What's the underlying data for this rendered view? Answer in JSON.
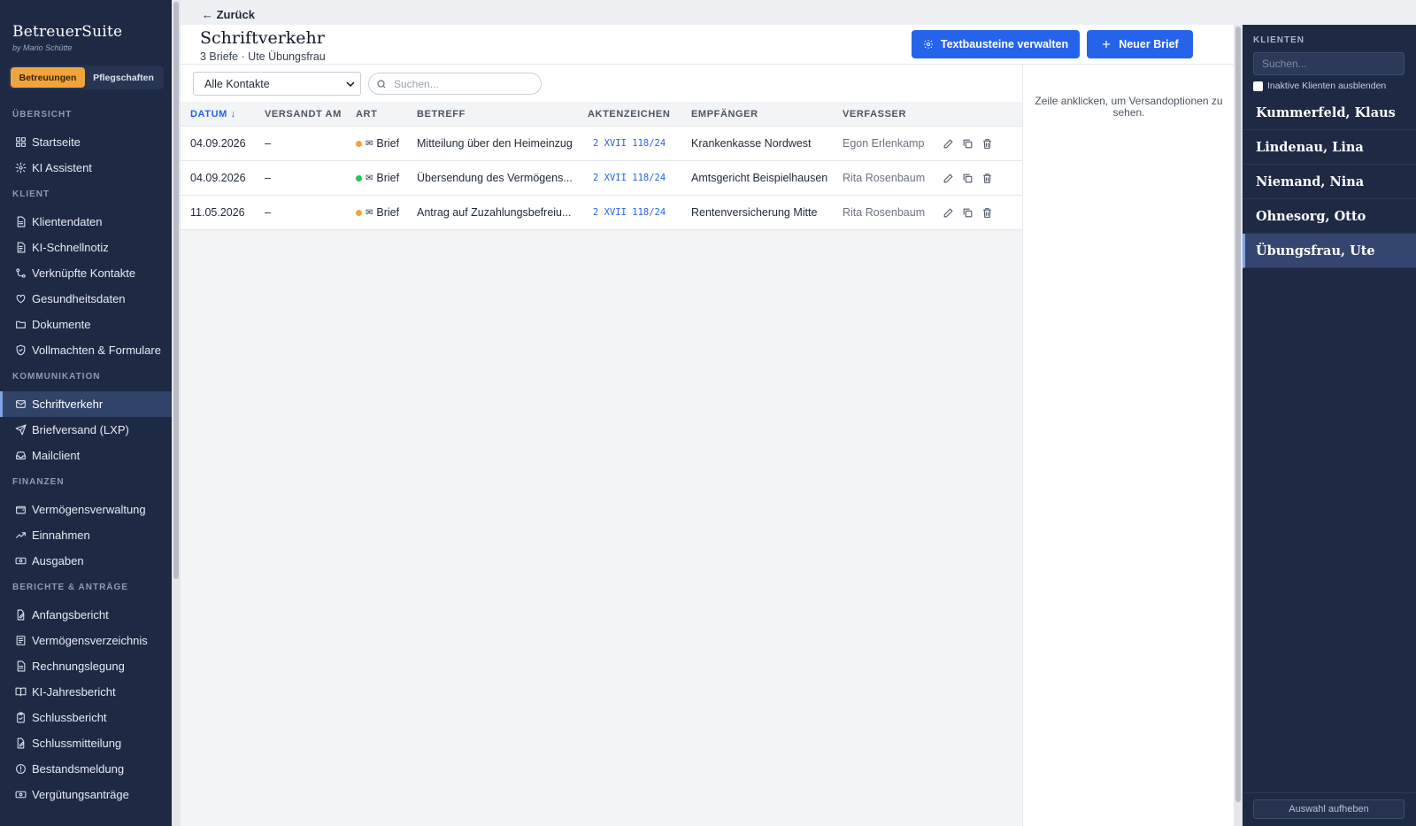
{
  "app": {
    "brand": "BetreuerSuite",
    "brand_sub": "by Mario Schütte",
    "modes": [
      "Betreuungen",
      "Pflegschaften"
    ]
  },
  "sidebar": {
    "sections": [
      {
        "title": "ÜBERSICHT",
        "items": [
          {
            "label": "Startseite",
            "icon": "home-icon"
          },
          {
            "label": "KI Assistent",
            "icon": "gear-icon"
          }
        ]
      },
      {
        "title": "KLIENT",
        "items": [
          {
            "label": "Klientendaten",
            "icon": "document-icon"
          },
          {
            "label": "KI-Schnellnotiz",
            "icon": "note-icon"
          },
          {
            "label": "Verknüpfte Kontakte",
            "icon": "link-icon"
          },
          {
            "label": "Gesundheitsdaten",
            "icon": "heart-icon"
          },
          {
            "label": "Dokumente",
            "icon": "folder-icon"
          },
          {
            "label": "Vollmachten & Formulare",
            "icon": "shield-icon"
          }
        ]
      },
      {
        "title": "KOMMUNIKATION",
        "items": [
          {
            "label": "Schriftverkehr",
            "icon": "mail-icon",
            "active": true
          },
          {
            "label": "Briefversand (LXP)",
            "icon": "send-icon"
          },
          {
            "label": "Mailclient",
            "icon": "inbox-icon"
          }
        ]
      },
      {
        "title": "FINANZEN",
        "items": [
          {
            "label": "Vermögensverwaltung",
            "icon": "wallet-icon"
          },
          {
            "label": "Einnahmen",
            "icon": "trend-up-icon"
          },
          {
            "label": "Ausgaben",
            "icon": "banknote-icon"
          }
        ]
      },
      {
        "title": "BERICHTE & ANTRÄGE",
        "items": [
          {
            "label": "Anfangsbericht",
            "icon": "file-edit-icon"
          },
          {
            "label": "Vermögensverzeichnis",
            "icon": "list-icon"
          },
          {
            "label": "Rechnungslegung",
            "icon": "document-icon"
          },
          {
            "label": "KI-Jahresbericht",
            "icon": "book-icon"
          },
          {
            "label": "Schlussbericht",
            "icon": "clipboard-icon"
          },
          {
            "label": "Schlussmitteilung",
            "icon": "file-edit-icon"
          },
          {
            "label": "Bestandsmeldung",
            "icon": "alert-icon"
          },
          {
            "label": "Vergütungsanträge",
            "icon": "banknote-icon"
          }
        ]
      }
    ]
  },
  "header": {
    "back_label": "← Zurück",
    "title": "Schriftverkehr",
    "subtitle": "3 Briefe · Ute Übungsfrau",
    "btn_textbausteine": "Textbausteine verwalten",
    "btn_new": "Neuer Brief"
  },
  "filters": {
    "contact_select": "Alle Kontakte",
    "search_placeholder": "Suchen..."
  },
  "table": {
    "columns": [
      "DATUM",
      "VERSANDT AM",
      "ART",
      "BETREFF",
      "AKTENZEICHEN",
      "EMPFÄNGER",
      "VERFASSER"
    ],
    "sort_indicator": "↓",
    "rows": [
      {
        "datum": "04.09.2026",
        "versandt": "–",
        "art": "Brief",
        "status_color": "#f0a53a",
        "betreff": "Mitteilung über den Heimeinzug",
        "az": "2 XVII 118/24",
        "empfaenger": "Krankenkasse Nordwest",
        "verfasser": "Egon Erlenkamp"
      },
      {
        "datum": "04.09.2026",
        "versandt": "–",
        "art": "Brief",
        "status_color": "#22c55e",
        "betreff": "Übersendung des Vermögens...",
        "az": "2 XVII 118/24",
        "empfaenger": "Amtsgericht Beispielhausen",
        "verfasser": "Rita Rosenbaum"
      },
      {
        "datum": "11.05.2026",
        "versandt": "–",
        "art": "Brief",
        "status_color": "#f0a53a",
        "betreff": "Antrag auf Zuzahlungsbefreiu...",
        "az": "2 XVII 118/24",
        "empfaenger": "Rentenversicherung Mitte",
        "verfasser": "Rita Rosenbaum"
      }
    ]
  },
  "detail": {
    "hint": "Zeile anklicken, um Versandoptionen zu sehen."
  },
  "clients": {
    "title": "KLIENTEN",
    "search_placeholder": "Suchen...",
    "hide_inactive": "Inaktive Klienten ausblenden",
    "items": [
      {
        "name": "Kummerfeld, Klaus"
      },
      {
        "name": "Lindenau, Lina"
      },
      {
        "name": "Niemand, Nina"
      },
      {
        "name": "Ohnesorg, Otto"
      },
      {
        "name": "Übungsfrau, Ute",
        "active": true
      }
    ],
    "clear_label": "Auswahl aufheben"
  },
  "colors": {
    "sidebar_bg": "#1e2a44",
    "accent": "#2563eb",
    "mode_active": "#f0a53a"
  }
}
